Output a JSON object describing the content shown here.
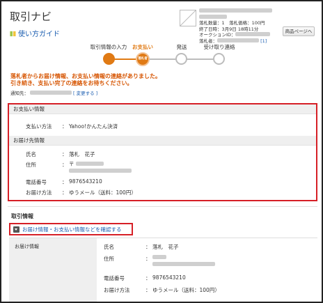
{
  "header": {
    "title": "取引ナビ",
    "guide_link": "使い方ガイド",
    "item_info": {
      "quantity_line": "落札数量：1　落札価格：100円",
      "end_time_line": "終了日時：3月9日 18時11分",
      "auction_id_label": "オークションID：",
      "winner_label": "落札者：",
      "winner_suffix": "[1]"
    },
    "goods_button": "商品ページへ"
  },
  "steps": [
    {
      "label": "取引情報の入力",
      "state": "done"
    },
    {
      "label": "お支払い",
      "state": "current",
      "badge": "落札者"
    },
    {
      "label": "発送",
      "state": "todo"
    },
    {
      "label": "受け取り連絡",
      "state": "todo"
    }
  ],
  "notice": {
    "line1": "落札者からお届け情報、お支払い情報の連絡がありました。",
    "line2": "引き続き、支払い完了の連絡をお待ちください。",
    "notify_label": "通知先：",
    "change_link": "[ 変更する ]"
  },
  "payment_section": {
    "heading": "お支払い情報",
    "method_label": "支払い方法",
    "sep": "：",
    "method_value": "Yahoo!かんたん決済"
  },
  "delivery_section": {
    "heading": "お届け先情報",
    "name_label": "氏名",
    "name_value": "落札　花子",
    "address_label": "住所",
    "postal_prefix": "〒",
    "phone_label": "電話番号",
    "phone_value": "9876543210",
    "method_label": "お届け方法",
    "method_value": "ゆうメール（送料：100円）"
  },
  "transaction": {
    "heading": "取引情報",
    "confirm_link": "お届け情報・お支払い情報などを確認する",
    "left_label": "お届け情報",
    "name_label": "氏名",
    "name_value": "落札　花子",
    "address_label": "住所",
    "phone_label": "電話番号",
    "phone_value": "9876543210",
    "method_label": "お届け方法",
    "method_value": "ゆうメール（送料：100円）"
  },
  "colors": {
    "accent": "#e07a14",
    "link": "#1a5db0",
    "highlight_border": "#d61f26",
    "notice": "#d65400"
  }
}
